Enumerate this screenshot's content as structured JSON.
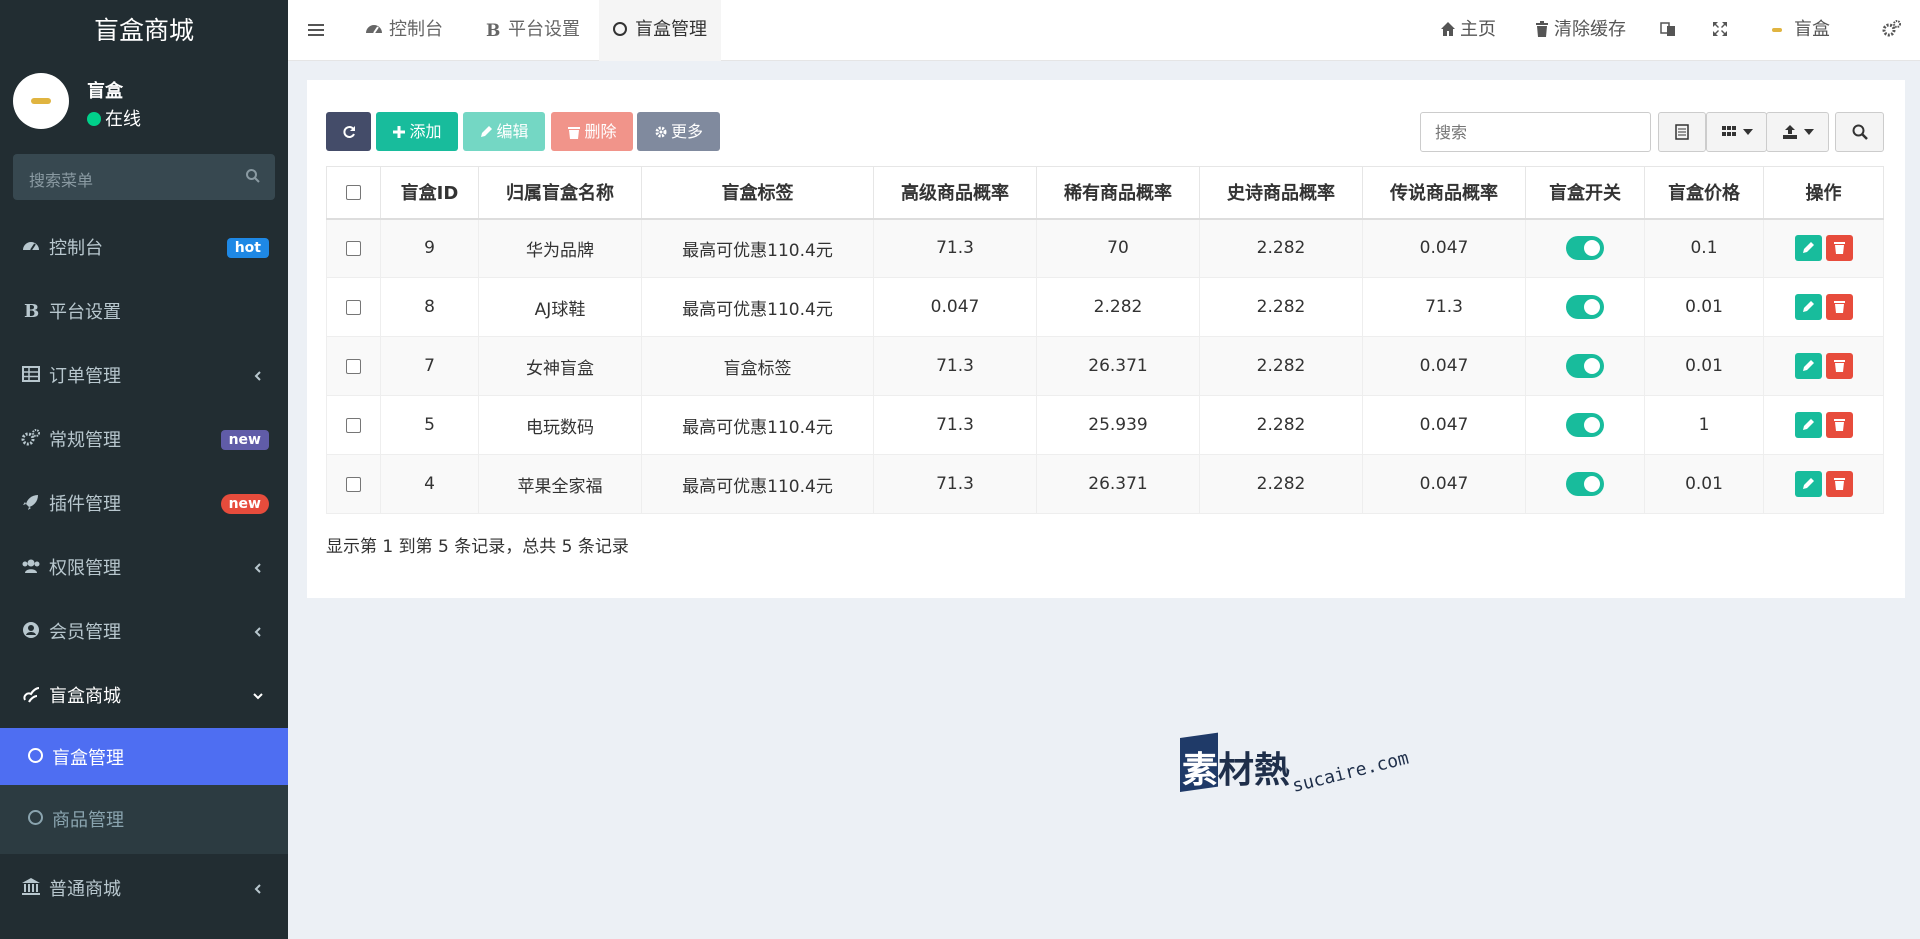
{
  "app": {
    "title": "盲盒商城"
  },
  "user": {
    "name": "盲盒",
    "status": "在线"
  },
  "sidebar": {
    "search_placeholder": "搜索菜单",
    "items": [
      {
        "label": "控制台",
        "icon": "dashboard-icon",
        "badge": "hot",
        "badge_color": "#3c8dbc"
      },
      {
        "label": "平台设置",
        "icon": "bold-b-icon"
      },
      {
        "label": "订单管理",
        "icon": "table-icon",
        "arrow": "left"
      },
      {
        "label": "常规管理",
        "icon": "cogs-icon",
        "badge": "new",
        "badge_color": "#605ca8"
      },
      {
        "label": "插件管理",
        "icon": "rocket-icon",
        "badge": "new",
        "badge_color": "#dd4b39"
      },
      {
        "label": "权限管理",
        "icon": "group-icon",
        "arrow": "left"
      },
      {
        "label": "会员管理",
        "icon": "user-circle-icon",
        "arrow": "left"
      },
      {
        "label": "盲盒商城",
        "icon": "blind-box-icon",
        "arrow": "down"
      },
      {
        "label": "普通商城",
        "icon": "bank-icon",
        "arrow": "left"
      }
    ],
    "submenu": [
      {
        "label": "盲盒管理",
        "active": true
      },
      {
        "label": "商品管理",
        "active": false
      }
    ]
  },
  "topbar": {
    "tabs": [
      {
        "label": "控制台",
        "icon": "dashboard-icon"
      },
      {
        "label": "平台设置",
        "icon": "bold-b-icon"
      },
      {
        "label": "盲盒管理",
        "icon": "circle-icon"
      }
    ],
    "home": "主页",
    "clear_cache": "清除缓存",
    "user_name": "盲盒"
  },
  "toolbar": {
    "add": "添加",
    "edit": "编辑",
    "delete": "删除",
    "more": "更多",
    "search_placeholder": "搜索"
  },
  "table": {
    "headers": [
      "盲盒ID",
      "归属盲盒名称",
      "盲盒标签",
      "高级商品概率",
      "稀有商品概率",
      "史诗商品概率",
      "传说商品概率",
      "盲盒开关",
      "盲盒价格",
      "操作"
    ],
    "rows": [
      {
        "id": "9",
        "name": "华为品牌",
        "tag": "最高可优惠110.4元",
        "advanced": "71.3",
        "rare": "70",
        "epic": "2.282",
        "legend": "0.047",
        "switch_on": true,
        "price": "0.1"
      },
      {
        "id": "8",
        "name": "AJ球鞋",
        "tag": "最高可优惠110.4元",
        "advanced": "0.047",
        "rare": "2.282",
        "epic": "2.282",
        "legend": "71.3",
        "switch_on": true,
        "price": "0.01"
      },
      {
        "id": "7",
        "name": "女神盲盒",
        "tag": "盲盒标签",
        "advanced": "71.3",
        "rare": "26.371",
        "epic": "2.282",
        "legend": "0.047",
        "switch_on": true,
        "price": "0.01"
      },
      {
        "id": "5",
        "name": "电玩数码",
        "tag": "最高可优惠110.4元",
        "advanced": "71.3",
        "rare": "25.939",
        "epic": "2.282",
        "legend": "0.047",
        "switch_on": true,
        "price": "1"
      },
      {
        "id": "4",
        "name": "苹果全家福",
        "tag": "最高可优惠110.4元",
        "advanced": "71.3",
        "rare": "26.371",
        "epic": "2.282",
        "legend": "0.047",
        "switch_on": true,
        "price": "0.01"
      }
    ]
  },
  "pagination": {
    "summary": "显示第 1 到第 5 条记录，总共 5 条记录"
  },
  "watermark": {
    "text": "素材熱",
    "url": "sucaire.com"
  },
  "colors": {
    "sidebar_bg": "#222d32",
    "active_blue": "#4e6ef2",
    "primary_green": "#18bc9c",
    "danger_red": "#e74c3c",
    "dark_btn": "#444c69"
  }
}
